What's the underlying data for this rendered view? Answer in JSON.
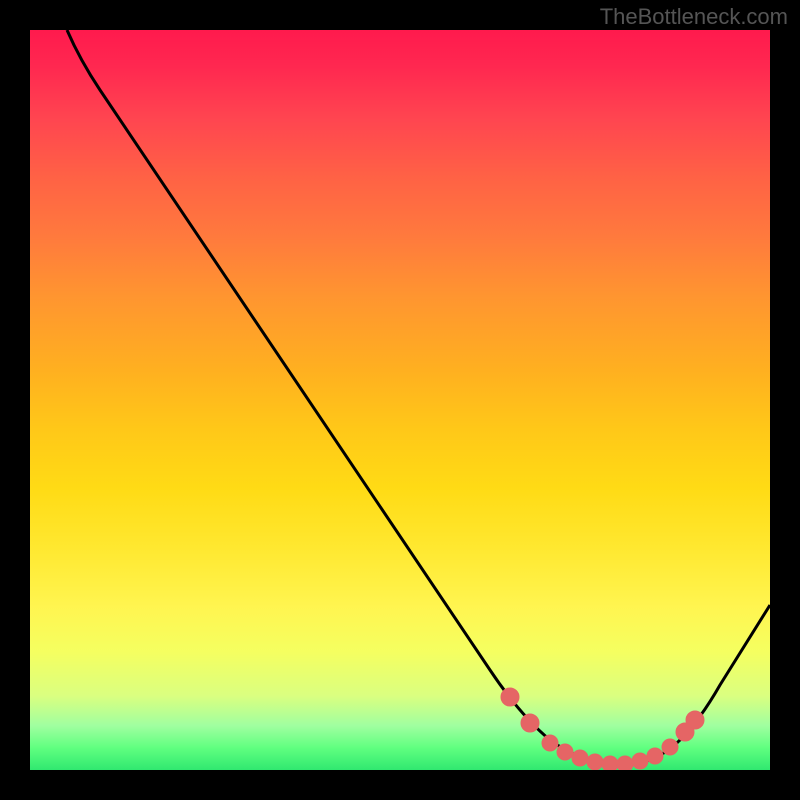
{
  "watermark": "TheBottleneck.com",
  "chart_data": {
    "type": "line",
    "title": "",
    "xlabel": "",
    "ylabel": "",
    "xlim": [
      0,
      100
    ],
    "ylim": [
      0,
      100
    ],
    "curve_description": "Bottleneck percentage curve - descends from top-left, reaches minimum (optimal zone) around x=70-85, rises again on right",
    "curve_points": [
      {
        "x": 5,
        "y": 100
      },
      {
        "x": 9,
        "y": 95
      },
      {
        "x": 14,
        "y": 87
      },
      {
        "x": 20,
        "y": 78
      },
      {
        "x": 26,
        "y": 69
      },
      {
        "x": 32,
        "y": 60
      },
      {
        "x": 38,
        "y": 51
      },
      {
        "x": 44,
        "y": 42
      },
      {
        "x": 50,
        "y": 33
      },
      {
        "x": 56,
        "y": 24
      },
      {
        "x": 61,
        "y": 16
      },
      {
        "x": 66,
        "y": 9
      },
      {
        "x": 70,
        "y": 4
      },
      {
        "x": 74,
        "y": 1.5
      },
      {
        "x": 78,
        "y": 0.5
      },
      {
        "x": 82,
        "y": 0.5
      },
      {
        "x": 85,
        "y": 1.5
      },
      {
        "x": 88,
        "y": 4
      },
      {
        "x": 91,
        "y": 8
      },
      {
        "x": 95,
        "y": 14
      },
      {
        "x": 100,
        "y": 22
      }
    ],
    "optimal_points_x": [
      66,
      68,
      70,
      72,
      74,
      76,
      78,
      80,
      82,
      84,
      86,
      88,
      89
    ],
    "gradient_colors": {
      "top": "#ff1a4d",
      "middle": "#ffdb15",
      "bottom": "#30e870"
    }
  }
}
